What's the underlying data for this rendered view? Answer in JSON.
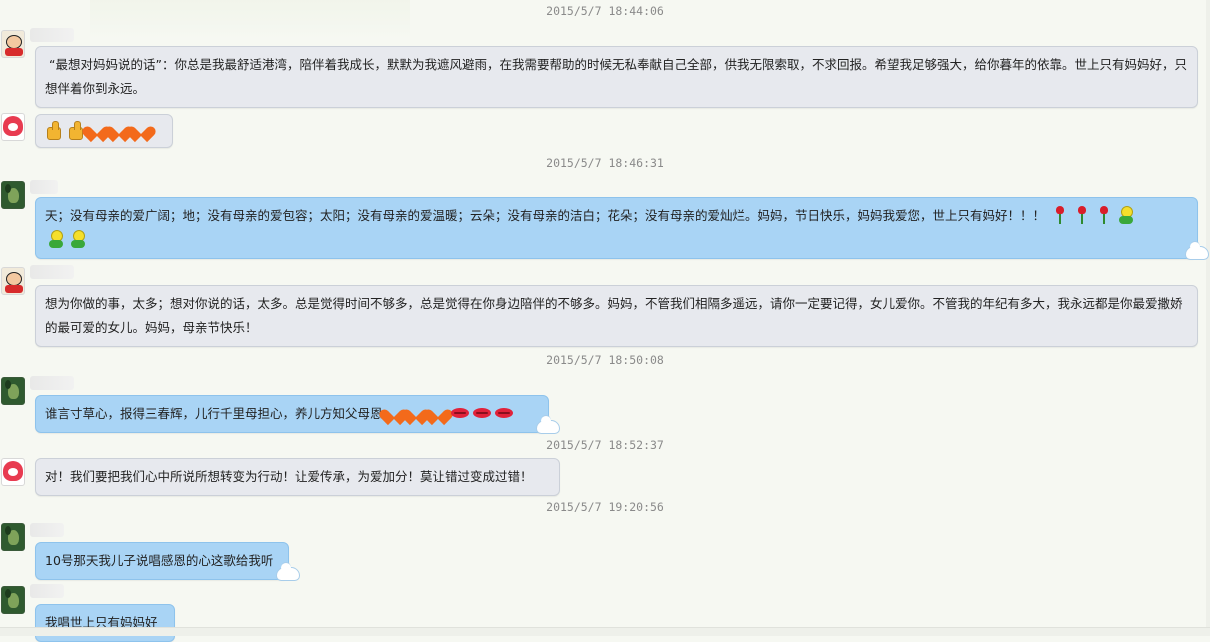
{
  "timestamps": {
    "t1": "2015/5/7 18:44:06",
    "t2": "2015/5/7 18:46:31",
    "t3": "2015/5/7 18:50:08",
    "t4": "2015/5/7 18:52:37",
    "t5": "2015/5/7 19:20:56"
  },
  "messages": {
    "m1": "“最想对妈妈说的话”：你总是我最舒适港湾，陪伴着我成长，默默为我遮风避雨，在我需要帮助的时候无私奉献自己全部，供我无限索取，不求回报。希望我足够强大，给你暮年的依靠。世上只有妈妈好，只想伴着你到永远。",
    "m2": "",
    "m3": "天；没有母亲的爱广阔；地；没有母亲的爱包容；太阳；没有母亲的爱温暖；云朵；没有母亲的洁白；花朵；没有母亲的爱灿烂。妈妈，节日快乐，妈妈我爱您，世上只有妈好！！！",
    "m4": "想为你做的事，太多；想对你说的话，太多。总是觉得时间不够多，总是觉得在你身边陪伴的不够多。妈妈，不管我们相隔多遥远，请你一定要记得，女儿爱你。不管我的年纪有多大，我永远都是你最爱撒娇的最可爱的女儿。妈妈，母亲节快乐！",
    "m5": "谁言寸草心，报得三春辉，儿行千里母担心，养儿方知父母恩",
    "m6": "对！我们要把我们心中所说所想转变为行动！让爱传承，为爱加分！莫让错过变成过错！",
    "m7": "10号那天我儿子说唱感恩的心这歌给我听",
    "m8": "我唱世上只有妈妈好"
  },
  "emoticons": {
    "thumb": "thumbs-up",
    "heart": "heart",
    "rose": "rose",
    "hug": "hug",
    "lips": "lips"
  },
  "colors": {
    "bubble_gray": "#e7e9ee",
    "bubble_blue": "#a9d4f5",
    "timestamp": "#8a8a8a"
  }
}
